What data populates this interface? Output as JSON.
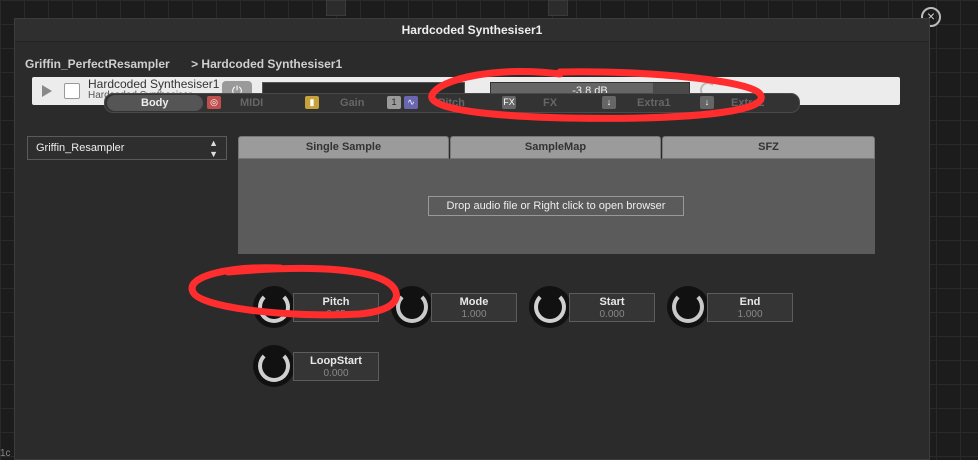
{
  "window": {
    "title": "Hardcoded Synthesiser1"
  },
  "breadcrumb": [
    "Griffin_PerfectResampler",
    "> Hardcoded Synthesiser1"
  ],
  "module": {
    "name": "Hardcoded Synthesiser1",
    "type": "Hardcoded Synthesiser",
    "power_icon": "power-icon",
    "gain": {
      "text": "-3.8 dB",
      "level": 0.82
    }
  },
  "tabs": [
    {
      "label": "Body",
      "icon": "",
      "active": true
    },
    {
      "label": "MIDI",
      "icon": "midi-processor-icon",
      "color": "#c0504d"
    },
    {
      "label": "Gain",
      "icon": "gain-modulator-icon",
      "color": "#c7a23a"
    },
    {
      "label": "Pitch",
      "icon": "pitch-modulator-icon",
      "color": "#6b66b0"
    },
    {
      "label": "FX",
      "icon": "fx-icon",
      "color": "#777"
    },
    {
      "label": "Extra1",
      "icon": "extra-icon",
      "color": "#777"
    },
    {
      "label": "Extra2",
      "icon": "extra-icon",
      "color": "#777"
    }
  ],
  "dropdown": {
    "value": "Griffin_Resampler"
  },
  "sample_tabs": [
    "Single Sample",
    "SampleMap",
    "SFZ"
  ],
  "drop_area": {
    "text": "Drop audio file or Right click to open browser"
  },
  "knobs": [
    {
      "name": "Pitch",
      "value": "0.65"
    },
    {
      "name": "Mode",
      "value": "1.000"
    },
    {
      "name": "Start",
      "value": "0.000"
    },
    {
      "name": "End",
      "value": "1.000"
    },
    {
      "name": "LoopStart",
      "value": "0.000"
    }
  ],
  "corner_tag": "1c",
  "colors": {
    "annotation": "#ff2d2d",
    "header_bg": "#ececec",
    "panel_bg": "#2b2b2b"
  }
}
